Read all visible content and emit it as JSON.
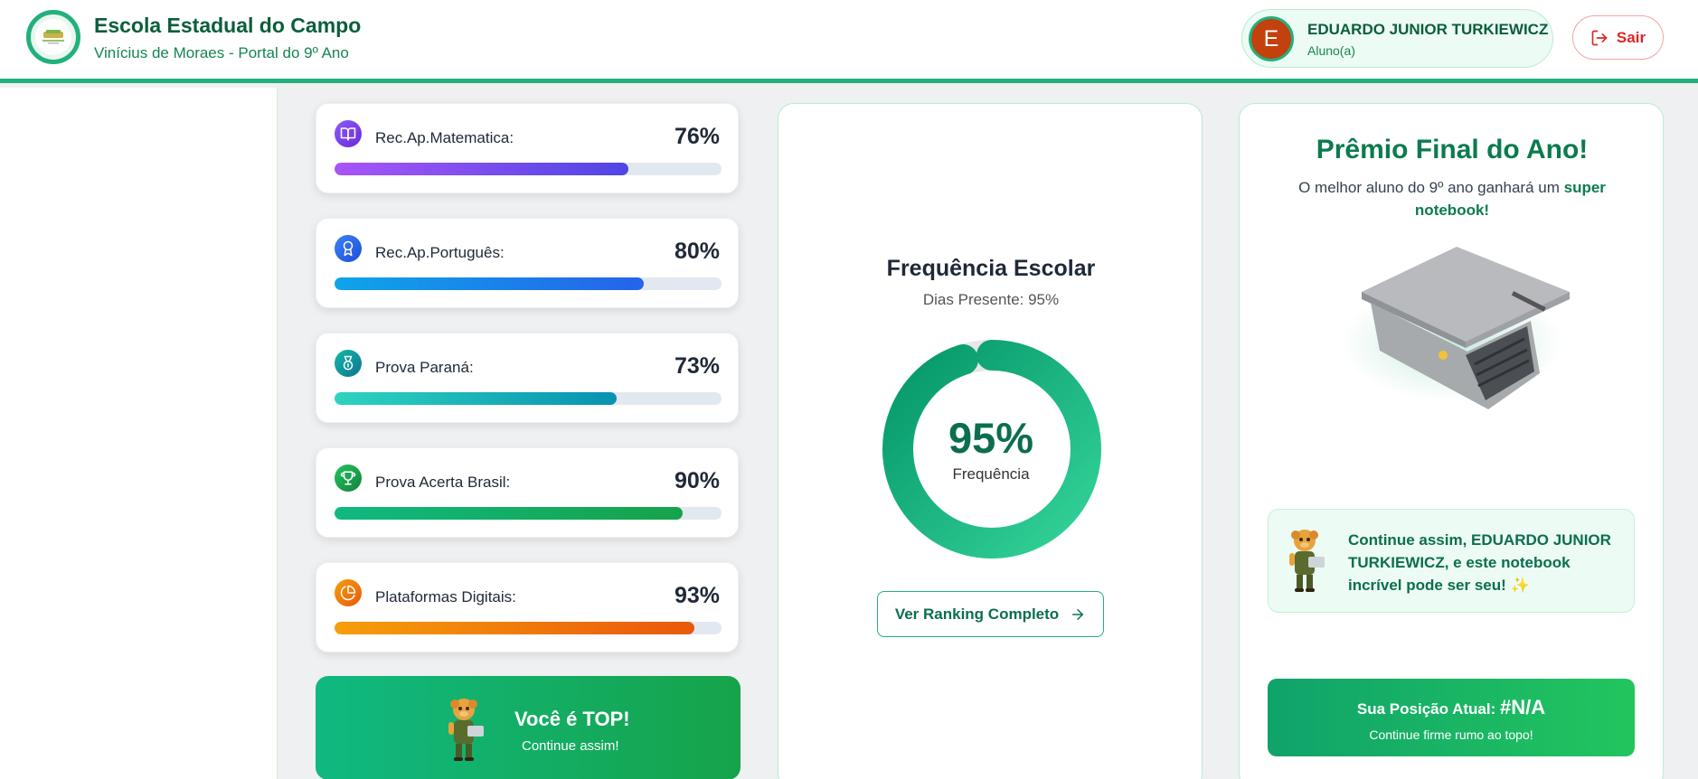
{
  "header": {
    "school_name": "Escola Estadual do Campo",
    "subtitle": "Vinícius de Moraes - Portal do 9º Ano",
    "user_initial": "E",
    "user_name": "EDUARDO JUNIOR TURKIEWICZ",
    "user_role": "Aluno(a)",
    "logout_label": "Sair",
    "logout_icon": "logout-icon"
  },
  "stats": [
    {
      "label": "Rec.Ap.Matematica:",
      "percent": "76%",
      "value": 0.76,
      "icon": "book-icon"
    },
    {
      "label": "Rec.Ap.Português:",
      "percent": "80%",
      "value": 0.8,
      "icon": "award-icon"
    },
    {
      "label": "Prova Paraná:",
      "percent": "73%",
      "value": 0.73,
      "icon": "medal-icon"
    },
    {
      "label": "Prova Acerta Brasil:",
      "percent": "90%",
      "value": 0.9,
      "icon": "trophy-icon"
    },
    {
      "label": "Plataformas Digitais:",
      "percent": "93%",
      "value": 0.93,
      "icon": "pie-chart-icon"
    }
  ],
  "top_card": {
    "title": "Você é TOP!",
    "subtitle": "Continue assim!"
  },
  "frequency": {
    "title": "Frequência Escolar",
    "subtitle": "Dias Presente: 95%",
    "percent": "95%",
    "value": 0.95,
    "label": "Frequência",
    "ranking_button": "Ver Ranking Completo"
  },
  "prize": {
    "title": "Prêmio Final do Ano!",
    "desc_prefix": "O melhor aluno do 9º ano ganhará um ",
    "desc_highlight": "super notebook!",
    "encouragement": "Continue assim, EDUARDO JUNIOR TURKIEWICZ, e este notebook incrível pode ser seu! ✨",
    "position_label": "Sua Posição Atual: ",
    "position_value": "#N/A",
    "position_sub": "Continue firme rumo ao topo!"
  },
  "colors": {
    "brand": "#22b07d",
    "brand_dark": "#0b5e3b",
    "danger": "#dc2626"
  }
}
